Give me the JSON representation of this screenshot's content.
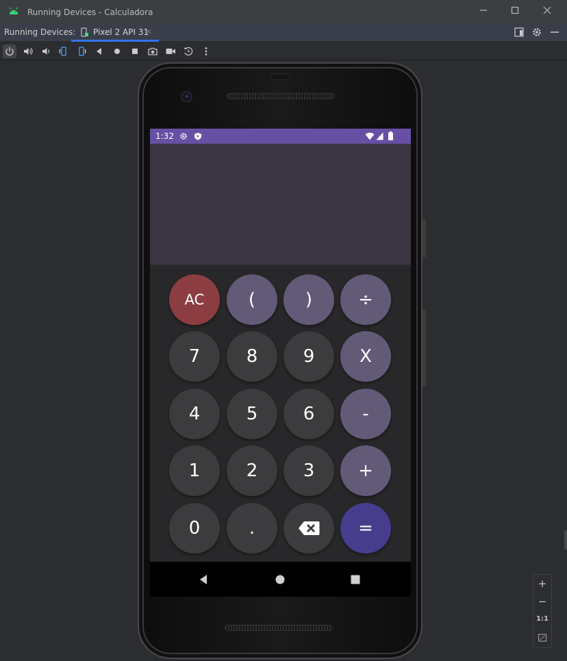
{
  "window": {
    "title": "Running Devices - Calculadora",
    "icon": "android-icon",
    "controls": [
      "minimize",
      "maximize",
      "close"
    ]
  },
  "tool_window": {
    "label": "Running Devices:",
    "tab": {
      "label": "Pixel 2 API 31",
      "icon": "device-icon",
      "close": "×"
    },
    "header_icons": [
      "layout-icon",
      "gear-icon",
      "hide-icon"
    ]
  },
  "toolbar": {
    "buttons": [
      "power-icon",
      "volume-up-icon",
      "volume-down-icon",
      "rotate-left-icon",
      "rotate-right-icon",
      "back-icon",
      "home-icon",
      "overview-icon",
      "screenshot-icon",
      "screen-record-icon",
      "snapshot-icon",
      "more-icon"
    ]
  },
  "device": {
    "status_bar": {
      "time": "1:32",
      "icons": [
        "gear-icon",
        "shield-icon",
        "wifi-icon",
        "signal-icon",
        "battery-icon"
      ]
    },
    "display": {
      "expression": "",
      "result": ""
    },
    "keys": [
      [
        {
          "label": "AC",
          "kind": "clear"
        },
        {
          "label": "(",
          "kind": "op"
        },
        {
          "label": ")",
          "kind": "op"
        },
        {
          "label": "÷",
          "kind": "op"
        }
      ],
      [
        {
          "label": "7",
          "kind": "num"
        },
        {
          "label": "8",
          "kind": "num"
        },
        {
          "label": "9",
          "kind": "num"
        },
        {
          "label": "X",
          "kind": "op"
        }
      ],
      [
        {
          "label": "4",
          "kind": "num"
        },
        {
          "label": "5",
          "kind": "num"
        },
        {
          "label": "6",
          "kind": "num"
        },
        {
          "label": "-",
          "kind": "op"
        }
      ],
      [
        {
          "label": "1",
          "kind": "num"
        },
        {
          "label": "2",
          "kind": "num"
        },
        {
          "label": "3",
          "kind": "num"
        },
        {
          "label": "+",
          "kind": "op"
        }
      ],
      [
        {
          "label": "0",
          "kind": "num"
        },
        {
          "label": ".",
          "kind": "num"
        },
        {
          "label": "",
          "kind": "num",
          "icon": "backspace-icon"
        },
        {
          "label": "=",
          "kind": "eq"
        }
      ]
    ],
    "nav": [
      "nav-back-icon",
      "nav-home-icon",
      "nav-recents-icon"
    ]
  },
  "zoom": {
    "in": "+",
    "out": "−",
    "actual": "1:1",
    "fit_icon": "fit-screen-icon"
  },
  "colors": {
    "status_bar": "#6750a4",
    "display_bg": "#3c3544",
    "keypad_bg": "#28282a",
    "num_key": "#3c3c3e",
    "op_key": "#635a78",
    "clear_key": "#8c3d42",
    "equals_key": "#463d8c",
    "tab_underline": "#3574f0"
  }
}
